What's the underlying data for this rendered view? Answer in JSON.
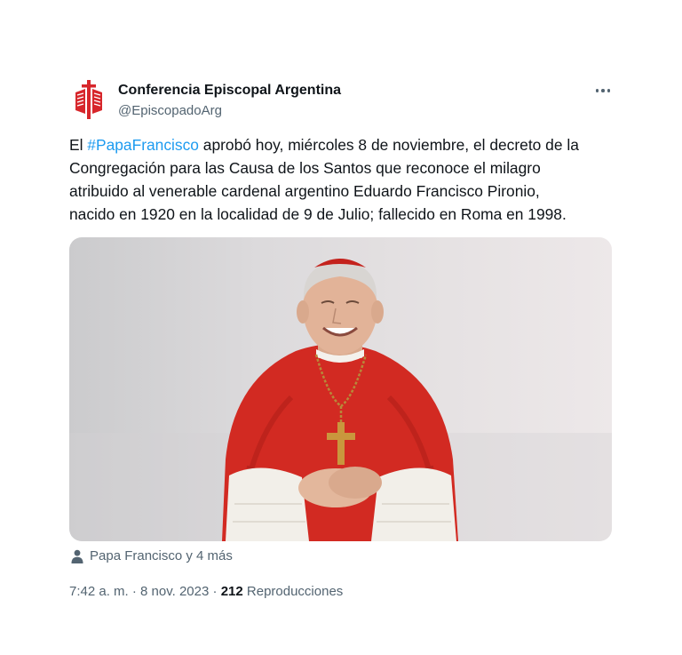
{
  "author": {
    "name": "Conferencia Episcopal Argentina",
    "handle": "@EpiscopadoArg"
  },
  "more_icon": "more-horizontal-icon",
  "tweet": {
    "line1_prefix": "El ",
    "hashtag": "#PapaFrancisco",
    "line1_suffix": " aprobó hoy, miércoles 8 de noviembre, el decreto de la",
    "line2": "Congregación para las Causa de los Santos que reconoce el milagro",
    "line3": "atribuido al venerable cardenal argentino Eduardo Francisco Pironio,",
    "line4": "nacido en 1920 en la localidad de 9 de Julio; fallecido en Roma en 1998."
  },
  "tagged": {
    "icon": "person-icon",
    "text": "Papa Francisco y 4 más"
  },
  "meta": {
    "time": "7:42 a. m.",
    "separator": " · ",
    "date": "8 nov. 2023",
    "views_count": "212",
    "views_label": "Reproducciones"
  },
  "colors": {
    "accent": "#1d9bf0",
    "secondary_text": "#536471",
    "brand_red": "#d7262b",
    "cassock_red": "#d22a22"
  }
}
